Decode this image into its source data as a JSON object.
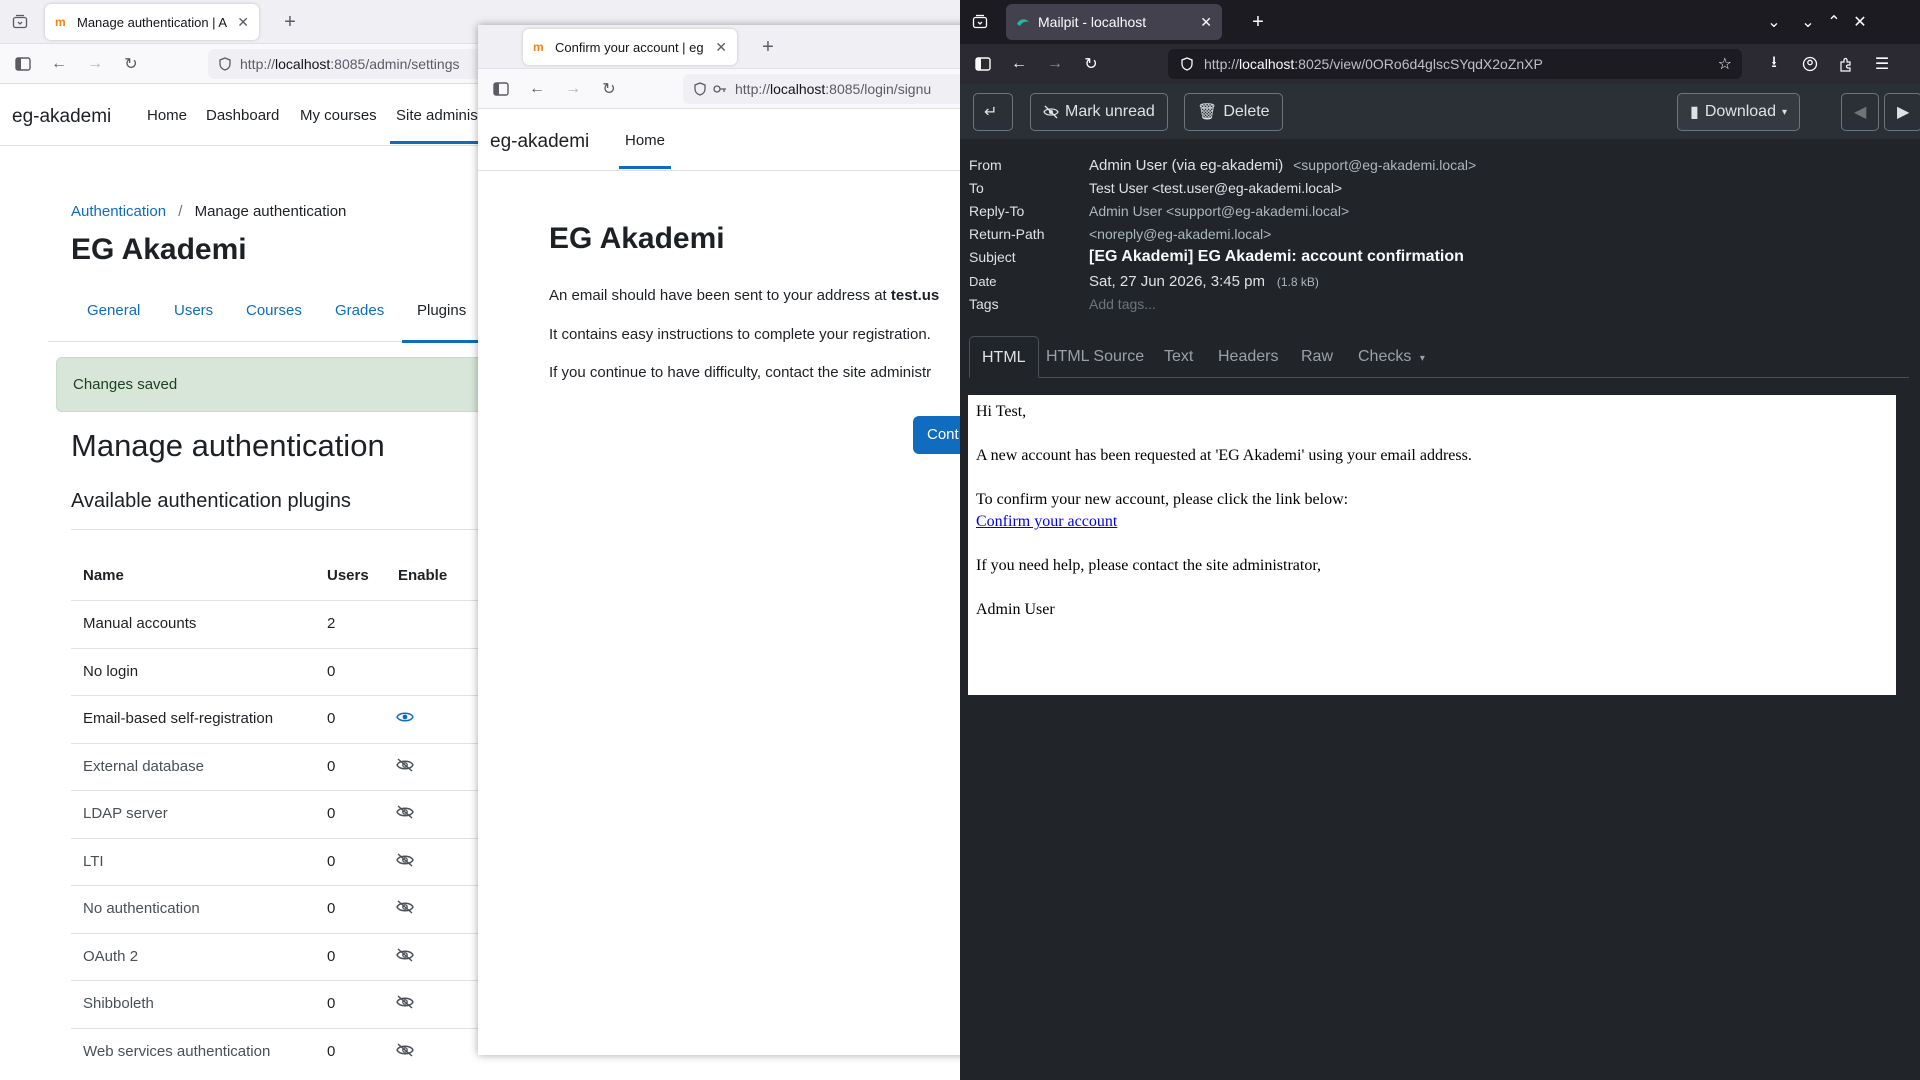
{
  "windows": {
    "left": {
      "tab_title": "Manage authentication | A",
      "url_prefix": "http://",
      "url_host": "localhost",
      "url_rest": ":8085/admin/settings",
      "brand": "eg-akademi",
      "nav": [
        "Home",
        "Dashboard",
        "My courses",
        "Site adminis"
      ],
      "breadcrumb": {
        "link": "Authentication",
        "sep": "/",
        "current": "Manage authentication"
      },
      "heading": "EG Akademi",
      "tabs": [
        "General",
        "Users",
        "Courses",
        "Grades",
        "Plugins"
      ],
      "alert": "Changes saved",
      "section_title": "Manage authentication",
      "subsection_title": "Available authentication plugins",
      "table": {
        "headers": [
          "Name",
          "Users",
          "Enable"
        ],
        "rows": [
          {
            "name": "Manual accounts",
            "users": "2",
            "enable": ""
          },
          {
            "name": "No login",
            "users": "0",
            "enable": ""
          },
          {
            "name": "Email-based self-registration",
            "users": "0",
            "enable": "eye-icon"
          },
          {
            "name": "External database",
            "users": "0",
            "enable": "eye-slash-icon"
          },
          {
            "name": "LDAP server",
            "users": "0",
            "enable": "eye-slash-icon"
          },
          {
            "name": "LTI",
            "users": "0",
            "enable": "eye-slash-icon"
          },
          {
            "name": "No authentication",
            "users": "0",
            "enable": "eye-slash-icon"
          },
          {
            "name": "OAuth 2",
            "users": "0",
            "enable": "eye-slash-icon"
          },
          {
            "name": "Shibboleth",
            "users": "0",
            "enable": "eye-slash-icon"
          },
          {
            "name": "Web services authentication",
            "users": "0",
            "enable": "eye-slash-icon"
          }
        ]
      }
    },
    "middle": {
      "tab_title": "Confirm your account | eg",
      "url_prefix": "http://",
      "url_host": "localhost",
      "url_rest": ":8085/login/signu",
      "brand": "eg-akademi",
      "nav_home": "Home",
      "page_title": "EG Akademi",
      "line1_text": "An email should have been sent to your address at ",
      "line1_bold": "test.us",
      "line2": "It contains easy instructions to complete your registration.",
      "line3": "If you continue to have difficulty, contact the site administr",
      "continue_btn": "Cont"
    },
    "right": {
      "tab_title": "Mailpit - localhost",
      "url_prefix": "http://",
      "url_host": "localhost",
      "url_rest": ":8025/view/0ORo6d4glscSYqdX2oZnXP",
      "toolbar": {
        "mark_unread": "Mark unread",
        "delete": "Delete",
        "download": "Download"
      },
      "headers": {
        "from_label": "From",
        "from_name": "Admin User  (via eg-akademi)",
        "from_addr": "<support@eg-akademi.local>",
        "to_label": "To",
        "to_value": "Test User <test.user@eg-akademi.local>",
        "reply_label": "Reply-To",
        "reply_value": "Admin User <support@eg-akademi.local>",
        "return_label": "Return-Path",
        "return_value": "<noreply@eg-akademi.local>",
        "subject_label": "Subject",
        "subject_value": "[EG Akademi] EG Akademi: account confirmation",
        "date_label": "Date",
        "date_value": "Sat, 27 Jun 2026, 3:45 pm",
        "size": "(1.8 kB)",
        "tags_label": "Tags",
        "tags_placeholder": "Add tags..."
      },
      "view_tabs": [
        "HTML",
        "HTML Source",
        "Text",
        "Headers",
        "Raw",
        "Checks"
      ],
      "email": {
        "greeting": "Hi Test,",
        "line1": "A new account has been requested at 'EG Akademi' using your email address.",
        "line2": "To confirm your new account, please click the link below:",
        "link": "Confirm your account",
        "line3": "If you need help, please contact the site administrator,",
        "signature": "Admin User"
      }
    }
  },
  "colors": {
    "moodle_blue": "#0f6cbf",
    "alert_bg": "#d7e6d8",
    "mailpit_dark": "#212529"
  }
}
